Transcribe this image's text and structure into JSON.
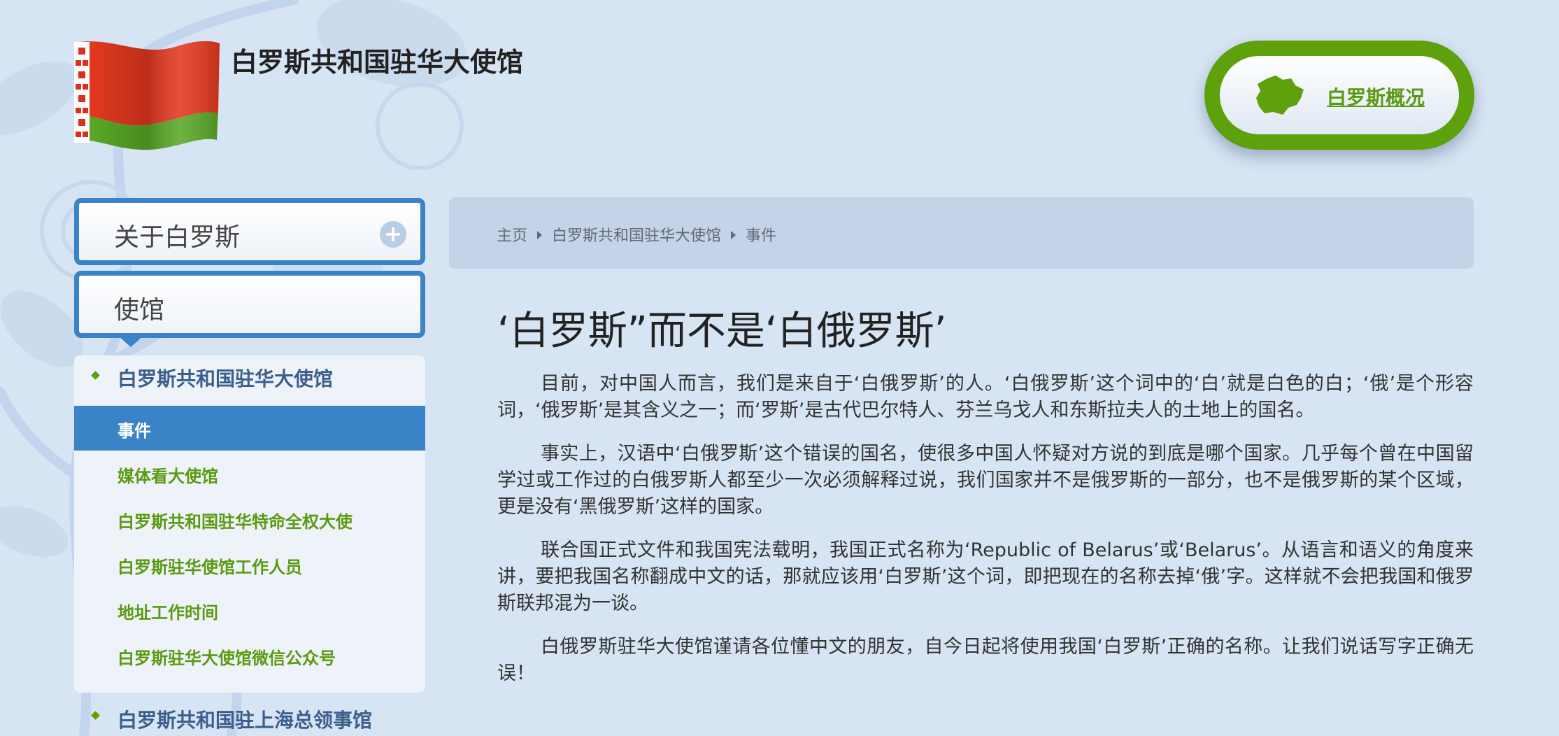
{
  "header": {
    "site_title": "白罗斯共和国驻华大使馆",
    "overview_button": "白罗斯概况"
  },
  "colors": {
    "accent_blue": "#3a83c6",
    "accent_green": "#5ea10c",
    "background": "#d7e4f3",
    "flag_red": "#d8321e",
    "flag_green": "#52a22a"
  },
  "icons": {
    "flag": "belarus-flag-icon",
    "overview": "belarus-map-icon",
    "expand": "plus-icon"
  },
  "sidebar": {
    "about_label": "关于白罗斯",
    "embassy_label": "使馆",
    "group1_title": "白罗斯共和国驻华大使馆",
    "items": [
      {
        "label": "事件",
        "active": true
      },
      {
        "label": "媒体看大使馆",
        "active": false
      },
      {
        "label": "白罗斯共和国驻华特命全权大使",
        "active": false
      },
      {
        "label": "白罗斯驻华使馆工作人员",
        "active": false
      },
      {
        "label": "地址工作时间",
        "active": false
      },
      {
        "label": "白罗斯驻华大使馆微信公众号",
        "active": false
      }
    ],
    "group2_title": "白罗斯共和国驻上海总领事馆"
  },
  "breadcrumb": {
    "home": "主页",
    "section": "白罗斯共和国驻华大使馆",
    "current": "事件"
  },
  "article": {
    "title": "‘白罗斯”而不是‘白俄罗斯’",
    "paragraphs": [
      "目前，对中国人而言，我们是来自于‘白俄罗斯’的人。‘白俄罗斯’这个词中的‘白’就是白色的白；‘俄’是个形容词，‘俄罗斯’是其含义之一；而‘罗斯’是古代巴尔特人、芬兰乌戈人和东斯拉夫人的土地上的国名。",
      "事实上，汉语中‘白俄罗斯’这个错误的国名，使很多中国人怀疑对方说的到底是哪个国家。几乎每个曾在中国留学过或工作过的白俄罗斯人都至少一次必须解释过说，我们国家并不是俄罗斯的一部分，也不是俄罗斯的某个区域，更是没有‘黑俄罗斯’这样的国家。",
      "联合国正式文件和我国宪法载明，我国正式名称为‘Republic of Belarus’或‘Belarus’。从语言和语义的角度来讲，要把我国名称翻成中文的话，那就应该用‘白罗斯’这个词，即把现在的名称去掉‘俄’字。这样就不会把我国和俄罗斯联邦混为一谈。",
      "白俄罗斯驻华大使馆谨请各位懂中文的朋友，自今日起将使用我国‘白罗斯’正确的名称。让我们说话写字正确无误！"
    ]
  }
}
